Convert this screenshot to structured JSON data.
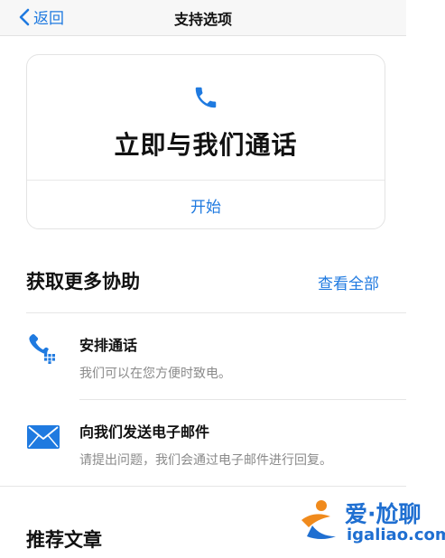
{
  "nav": {
    "back_label": "返回",
    "title": "支持选项"
  },
  "call_card": {
    "headline": "立即与我们通话",
    "start_label": "开始"
  },
  "more_help": {
    "title": "获取更多协助",
    "see_all_label": "查看全部",
    "options": [
      {
        "title": "安排通话",
        "description": "我们可以在您方便时致电。",
        "icon": "phone-schedule-icon"
      },
      {
        "title": "向我们发送电子邮件",
        "description": "请提出问题，我们会通过电子邮件进行回复。",
        "icon": "mail-icon"
      }
    ]
  },
  "recommended": {
    "title": "推荐文章"
  },
  "watermark": {
    "brand_cn": "爱·尬聊",
    "url": "igaliao.com"
  },
  "colors": {
    "accent": "#1f7ae0",
    "text": "#111111",
    "secondary": "#8a8a8a",
    "divider": "#e6e6e6"
  }
}
